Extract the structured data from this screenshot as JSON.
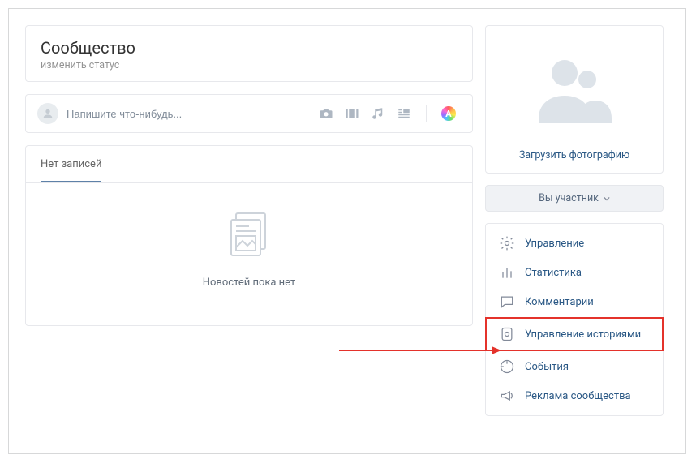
{
  "header": {
    "title": "Сообщество",
    "subtitle": "изменить статус"
  },
  "compose": {
    "placeholder": "Напишите что-нибудь...",
    "accent_badge": "A"
  },
  "tabs": {
    "active": "Нет записей"
  },
  "empty": {
    "text": "Новостей пока нет"
  },
  "photo": {
    "upload": "Загрузить фотографию"
  },
  "membership": {
    "label": "Вы участник"
  },
  "menu": {
    "items": [
      {
        "label": "Управление",
        "icon": "gear"
      },
      {
        "label": "Статистика",
        "icon": "stats"
      },
      {
        "label": "Комментарии",
        "icon": "comment"
      },
      {
        "label": "Управление историями",
        "icon": "stories",
        "highlighted": true
      },
      {
        "label": "События",
        "icon": "event"
      },
      {
        "label": "Реклама сообщества",
        "icon": "megaphone"
      }
    ]
  },
  "colors": {
    "link": "#2a5885",
    "highlight": "#e4322b"
  }
}
